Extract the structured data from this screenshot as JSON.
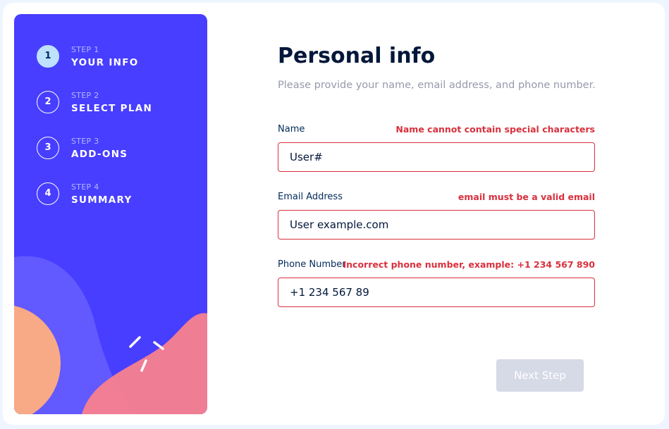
{
  "steps": [
    {
      "number": "1",
      "small": "STEP 1",
      "title": "YOUR INFO"
    },
    {
      "number": "2",
      "small": "STEP 2",
      "title": "SELECT PLAN"
    },
    {
      "number": "3",
      "small": "STEP 3",
      "title": "ADD-ONS"
    },
    {
      "number": "4",
      "small": "STEP 4",
      "title": "SUMMARY"
    }
  ],
  "form": {
    "title": "Personal info",
    "subtitle": "Please provide your name, email address, and phone number.",
    "name": {
      "label": "Name",
      "error": "Name cannot contain special characters",
      "value": "User#"
    },
    "email": {
      "label": "Email Address",
      "error": "email must be a valid email",
      "value": "User example.com"
    },
    "phone": {
      "label": "Phone Number",
      "error": "Incorrect phone number, example: +1 234 567 890",
      "value": "+1 234 567 89"
    }
  },
  "actions": {
    "next_label": "Next Step"
  },
  "colors": {
    "sidebar": "#483eff",
    "active_step": "#bee2fd",
    "error": "#d9303d",
    "disabled_button": "#d6d9e6"
  }
}
